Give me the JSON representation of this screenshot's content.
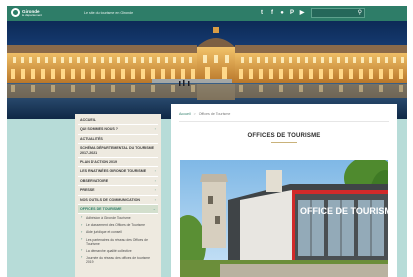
{
  "header": {
    "logo_name": "Gironde",
    "logo_sub": "le département",
    "tagline": "Le site du tourisme en Gironde",
    "social_icons": [
      {
        "icon": "twitter-icon",
        "glyph": "t"
      },
      {
        "icon": "facebook-icon",
        "glyph": "f"
      },
      {
        "icon": "flickr-icon",
        "glyph": "●"
      },
      {
        "icon": "pinterest-icon",
        "glyph": "P"
      },
      {
        "icon": "youtube-icon",
        "glyph": "▶"
      }
    ],
    "search": {
      "value": "",
      "placeholder": "",
      "icon": "search-icon"
    }
  },
  "sidebar": {
    "items": [
      {
        "label": "Accueil",
        "chevron": false
      },
      {
        "label": "Qui sommes nous ?",
        "chevron": true
      },
      {
        "label": "Actualités",
        "chevron": false
      },
      {
        "label": "Schéma départemental du tourisme 2017-2021",
        "chevron": false
      },
      {
        "label": "Plan d'action 2019",
        "chevron": false
      },
      {
        "label": "Les rnatinées Gironde tourisme",
        "chevron": true
      },
      {
        "label": "Observatoire",
        "chevron": true
      },
      {
        "label": "Presse",
        "chevron": true
      },
      {
        "label": "Nos outils de communication",
        "chevron": true
      },
      {
        "label": "Offices de tourisme",
        "chevron": true,
        "active": true
      }
    ],
    "sub_items": [
      "Adhésion à Gironde Tourisme",
      "Le classement des Offices de Tourisme",
      "Aide juridique et conseil",
      "Les partenaires du réseau des Offices de Tourisme",
      "La démarche qualité collective",
      "Journée du réseau des offices de tourisme 2019"
    ]
  },
  "main": {
    "breadcrumb": {
      "home": "Accueil",
      "separator": ">",
      "current": "Offices de Tourisme"
    },
    "title": "OFFICES DE TOURISME",
    "photo_sign": "OFFICE DE TOURISME"
  },
  "colors": {
    "brand_green": "#2e7d68",
    "page_background": "#b7dcd8",
    "sidebar_background": "#eeeae0",
    "title_underline": "#c9b27a"
  }
}
